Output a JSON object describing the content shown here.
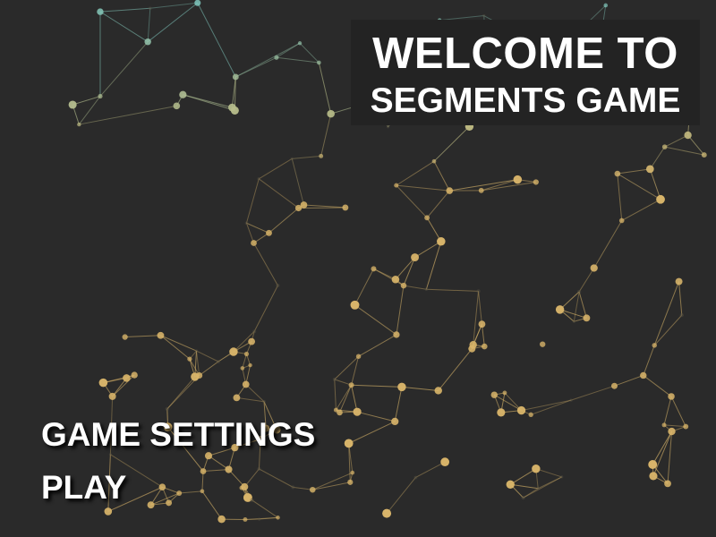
{
  "title": {
    "line1": "WELCOME TO",
    "line2": "SEGMENTS GAME"
  },
  "menu": [
    {
      "label": "GAME SETTINGS"
    },
    {
      "label": "PLAY"
    }
  ],
  "colors": {
    "background": "#2a2a2a",
    "title_box": "#232323",
    "node_gold": "#d9b56a",
    "node_teal": "#7fc9c0",
    "text": "#ffffff"
  }
}
